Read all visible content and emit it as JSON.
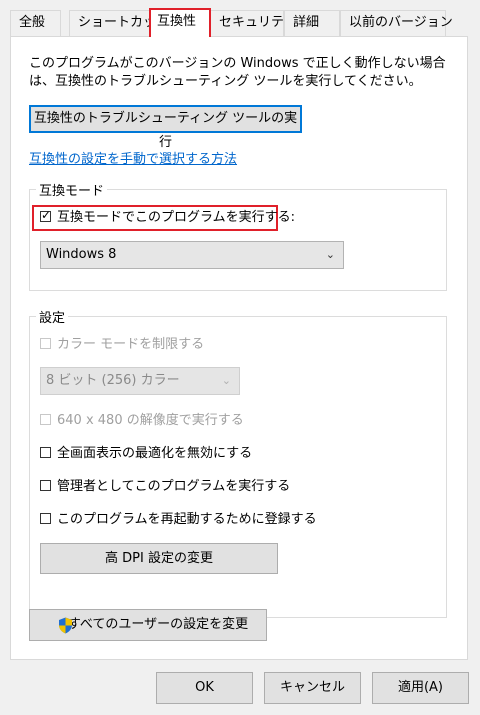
{
  "tabs": [
    {
      "label": "全般"
    },
    {
      "label": "ショートカット"
    },
    {
      "label": "互換性"
    },
    {
      "label": "セキュリティ"
    },
    {
      "label": "詳細"
    },
    {
      "label": "以前のバージョン"
    }
  ],
  "active_tab": "互換性",
  "description": "このプログラムがこのバージョンの Windows で正しく動作しない場合は、互換性のトラブルシューティング ツールを実行してください。",
  "troubleshooter_button": "互換性のトラブルシューティング ツールの実行",
  "manual_link": "互換性の設定を手動で選択する方法",
  "compat_mode": {
    "group_label": "互換モード",
    "checkbox_label": "互換モードでこのプログラムを実行する:",
    "checked": true,
    "selected_os": "Windows 8"
  },
  "settings": {
    "group_label": "設定",
    "reduced_color": {
      "label": "カラー モードを制限する",
      "checked": false,
      "enabled": false
    },
    "color_select": "8 ビット (256) カラー",
    "res_640": {
      "label": "640 x 480 の解像度で実行する",
      "checked": false,
      "enabled": false
    },
    "disable_fullscreen": {
      "label": "全画面表示の最適化を無効にする",
      "checked": false
    },
    "run_as_admin": {
      "label": "管理者としてこのプログラムを実行する",
      "checked": false
    },
    "register_restart": {
      "label": "このプログラムを再起動するために登録する",
      "checked": false
    },
    "dpi_button": "高 DPI 設定の変更"
  },
  "all_users_button": "すべてのユーザーの設定を変更",
  "footer": {
    "ok": "OK",
    "cancel": "キャンセル",
    "apply": "適用(A)"
  },
  "colors": {
    "highlight": "#e0202a",
    "link": "#0066cc",
    "focus_border": "#0078d7"
  }
}
